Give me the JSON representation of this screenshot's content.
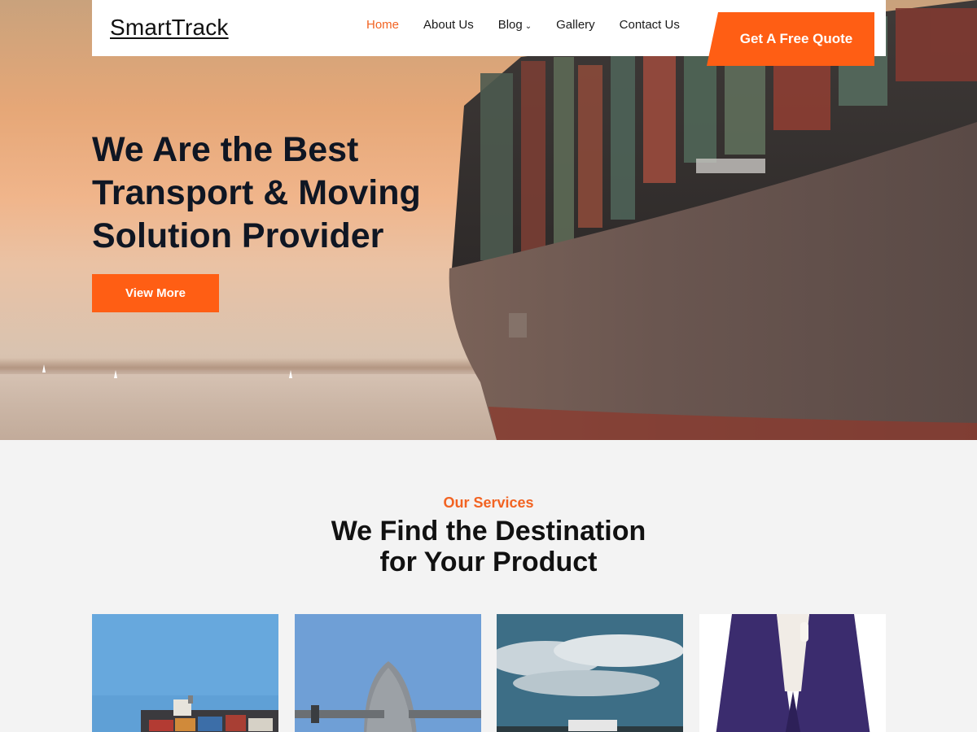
{
  "header": {
    "logo": "SmartTrack",
    "nav": [
      {
        "label": "Home",
        "active": true
      },
      {
        "label": "About Us",
        "active": false
      },
      {
        "label": "Blog",
        "active": false,
        "has_dropdown": true
      },
      {
        "label": "Gallery",
        "active": false
      },
      {
        "label": "Contact Us",
        "active": false
      }
    ],
    "dropdown_icon": "chevron-down-icon",
    "cta_label": "Get A Free Quote"
  },
  "hero": {
    "title_lines": [
      "We Are the Best",
      "Transport & Moving",
      "Solution Provider"
    ],
    "button_label": "View More",
    "image": "container-ship-at-sunset"
  },
  "services": {
    "eyebrow": "Our Services",
    "title_lines": [
      "We Find the Destination",
      "for Your Product"
    ],
    "cards": [
      {
        "image": "cargo-ship-port"
      },
      {
        "image": "cargo-airplane-nose"
      },
      {
        "image": "truck-under-clouds"
      },
      {
        "image": "business-person"
      }
    ]
  },
  "colors": {
    "accent": "#ff5e14",
    "heading": "#0f1623",
    "background": "#f3f3f3"
  }
}
